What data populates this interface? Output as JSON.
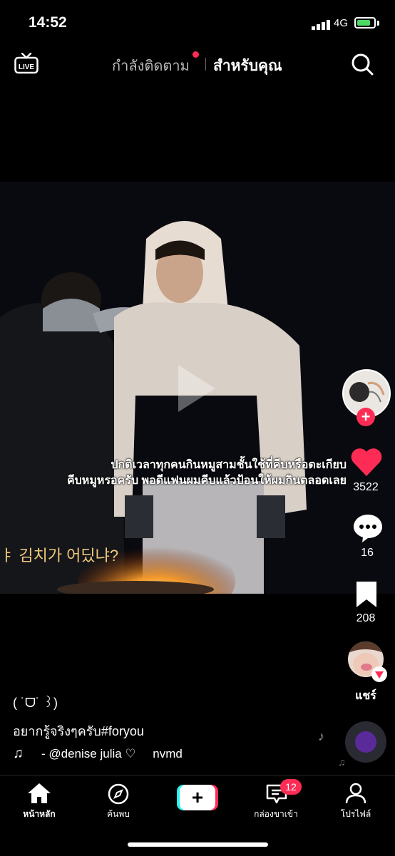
{
  "status": {
    "time": "14:52",
    "network": "4G"
  },
  "topnav": {
    "live_label": "LIVE",
    "following": "กำลังติดตาม",
    "foryou": "สำหรับคุณ"
  },
  "video": {
    "subtitle_line1": "ปกติเวลาทุกคนกินหมูสามชั้นใช้ที่คีบหรือตะเกียบ",
    "subtitle_line2": "คีบหมูหรอครับ พอดีแฟนผมคีบแล้วป้อนให้ผมกินตลอดเลย",
    "korean_caption": "ㅑ 김치가 어딨냐?"
  },
  "rail": {
    "likes": "3522",
    "comments": "16",
    "saves": "208",
    "share_label": "แชร์"
  },
  "post": {
    "emoticon": "( ˙ᗜ˙ ꒱)",
    "caption": "อยากรู้จริงๆครับ#foryou",
    "music": "- @denise julia ♡     nvmd"
  },
  "navbar": {
    "home": "หน้าหลัก",
    "discover": "ค้นพบ",
    "inbox": "กล่องขาเข้า",
    "inbox_badge": "12",
    "profile": "โปรไฟล์"
  },
  "colors": {
    "accent": "#fe2c55",
    "battery": "#4cd964"
  }
}
